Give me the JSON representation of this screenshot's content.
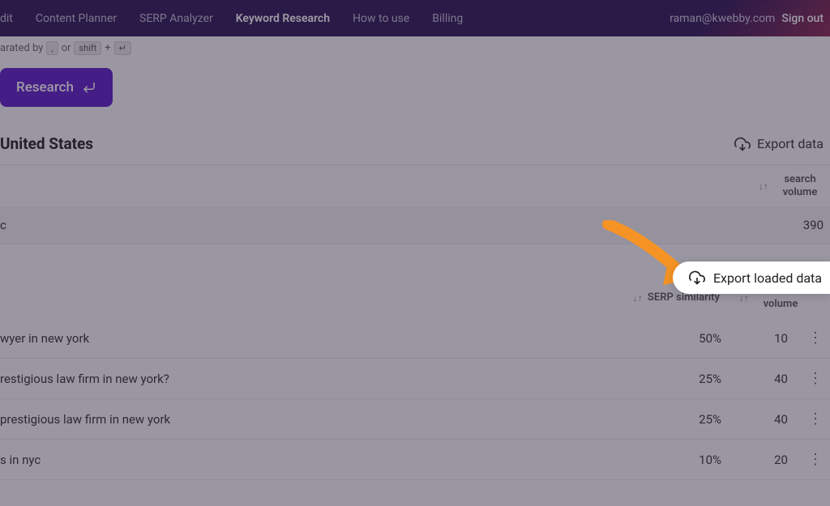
{
  "nav": {
    "items": [
      "dit",
      "Content Planner",
      "SERP Analyzer",
      "Keyword Research",
      "How to use",
      "Billing"
    ],
    "active_index": 3,
    "user_email": "raman@kwebby.com",
    "sign_out": "Sign out"
  },
  "hint": {
    "prefix": "arated by",
    "key1": ",",
    "or": "or",
    "key2": "shift",
    "plus": "+",
    "key3": "↵"
  },
  "research_button": "Research",
  "location": "United States",
  "export_data": "Export data",
  "table1": {
    "headers": {
      "search_volume": "search volume"
    },
    "row": {
      "keyword": "c",
      "volume": "390"
    }
  },
  "export_popup": "Export loaded data",
  "table2": {
    "headers": {
      "serp_similarity": "SERP similarity",
      "search_volume": "search volume"
    },
    "rows": [
      {
        "keyword": "wyer in new york",
        "serp": "50%",
        "volume": "10"
      },
      {
        "keyword": "restigious law firm in new york?",
        "serp": "25%",
        "volume": "40"
      },
      {
        "keyword": "prestigious law firm in new york",
        "serp": "25%",
        "volume": "40"
      },
      {
        "keyword": "s in nyc",
        "serp": "10%",
        "volume": "20"
      }
    ]
  }
}
